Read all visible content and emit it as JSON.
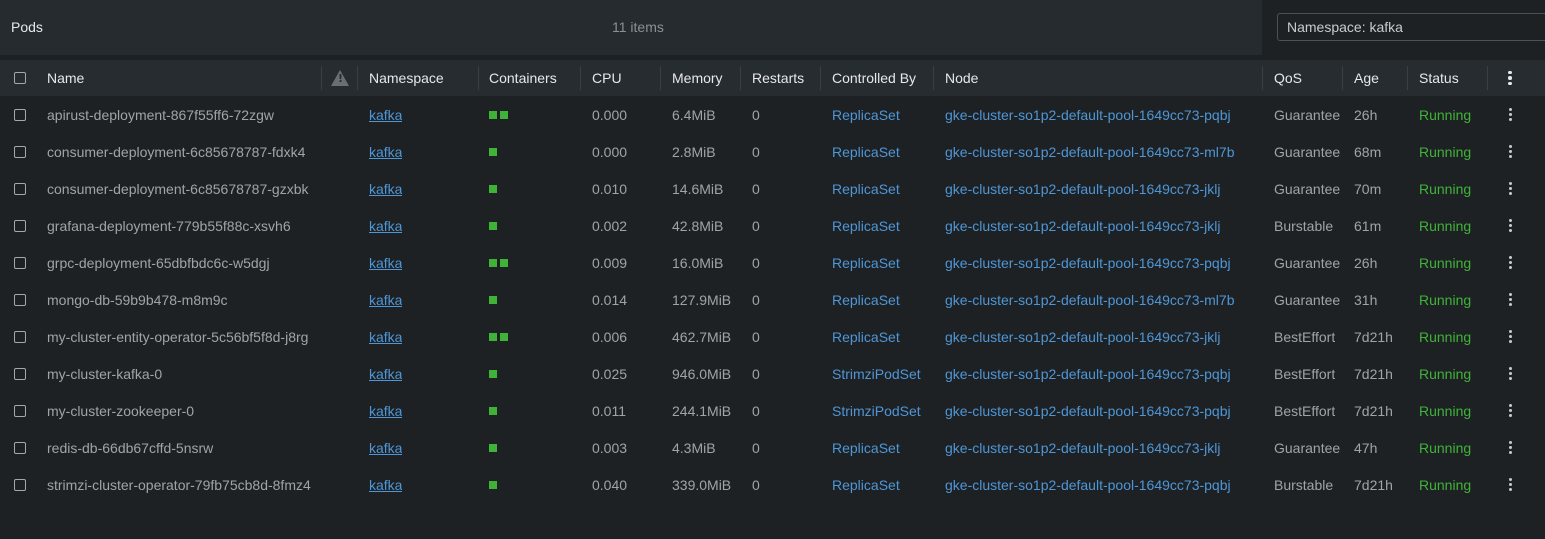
{
  "header": {
    "title": "Pods",
    "item_count": "11 items",
    "namespace_filter": "Namespace: kafka"
  },
  "columns": [
    "Name",
    "Namespace",
    "Containers",
    "CPU",
    "Memory",
    "Restarts",
    "Controlled By",
    "Node",
    "QoS",
    "Age",
    "Status"
  ],
  "column_icons": {
    "warning": "warning-triangle-icon",
    "menu": "kebab-menu-icon"
  },
  "colors": {
    "link": "#4e96d6",
    "running": "#3fb338",
    "container_ok": "#3fb338"
  },
  "pods": [
    {
      "name": "apirust-deployment-867f55ff6-72zgw",
      "namespace": "kafka",
      "containers": 2,
      "cpu": "0.000",
      "memory": "6.4MiB",
      "restarts": "0",
      "controlled_by": "ReplicaSet",
      "node": "gke-cluster-so1p2-default-pool-1649cc73-pqbj",
      "qos": "Guarantee",
      "age": "26h",
      "status": "Running"
    },
    {
      "name": "consumer-deployment-6c85678787-fdxk4",
      "namespace": "kafka",
      "containers": 1,
      "cpu": "0.000",
      "memory": "2.8MiB",
      "restarts": "0",
      "controlled_by": "ReplicaSet",
      "node": "gke-cluster-so1p2-default-pool-1649cc73-ml7b",
      "qos": "Guarantee",
      "age": "68m",
      "status": "Running"
    },
    {
      "name": "consumer-deployment-6c85678787-gzxbk",
      "namespace": "kafka",
      "containers": 1,
      "cpu": "0.010",
      "memory": "14.6MiB",
      "restarts": "0",
      "controlled_by": "ReplicaSet",
      "node": "gke-cluster-so1p2-default-pool-1649cc73-jklj",
      "qos": "Guarantee",
      "age": "70m",
      "status": "Running"
    },
    {
      "name": "grafana-deployment-779b55f88c-xsvh6",
      "namespace": "kafka",
      "containers": 1,
      "cpu": "0.002",
      "memory": "42.8MiB",
      "restarts": "0",
      "controlled_by": "ReplicaSet",
      "node": "gke-cluster-so1p2-default-pool-1649cc73-jklj",
      "qos": "Burstable",
      "age": "61m",
      "status": "Running"
    },
    {
      "name": "grpc-deployment-65dbfbdc6c-w5dgj",
      "namespace": "kafka",
      "containers": 2,
      "cpu": "0.009",
      "memory": "16.0MiB",
      "restarts": "0",
      "controlled_by": "ReplicaSet",
      "node": "gke-cluster-so1p2-default-pool-1649cc73-pqbj",
      "qos": "Guarantee",
      "age": "26h",
      "status": "Running"
    },
    {
      "name": "mongo-db-59b9b478-m8m9c",
      "namespace": "kafka",
      "containers": 1,
      "cpu": "0.014",
      "memory": "127.9MiB",
      "restarts": "0",
      "controlled_by": "ReplicaSet",
      "node": "gke-cluster-so1p2-default-pool-1649cc73-ml7b",
      "qos": "Guarantee",
      "age": "31h",
      "status": "Running"
    },
    {
      "name": "my-cluster-entity-operator-5c56bf5f8d-j8rg",
      "namespace": "kafka",
      "containers": 2,
      "cpu": "0.006",
      "memory": "462.7MiB",
      "restarts": "0",
      "controlled_by": "ReplicaSet",
      "node": "gke-cluster-so1p2-default-pool-1649cc73-jklj",
      "qos": "BestEffort",
      "age": "7d21h",
      "status": "Running"
    },
    {
      "name": "my-cluster-kafka-0",
      "namespace": "kafka",
      "containers": 1,
      "cpu": "0.025",
      "memory": "946.0MiB",
      "restarts": "0",
      "controlled_by": "StrimziPodSet",
      "node": "gke-cluster-so1p2-default-pool-1649cc73-pqbj",
      "qos": "BestEffort",
      "age": "7d21h",
      "status": "Running"
    },
    {
      "name": "my-cluster-zookeeper-0",
      "namespace": "kafka",
      "containers": 1,
      "cpu": "0.011",
      "memory": "244.1MiB",
      "restarts": "0",
      "controlled_by": "StrimziPodSet",
      "node": "gke-cluster-so1p2-default-pool-1649cc73-pqbj",
      "qos": "BestEffort",
      "age": "7d21h",
      "status": "Running"
    },
    {
      "name": "redis-db-66db67cffd-5nsrw",
      "namespace": "kafka",
      "containers": 1,
      "cpu": "0.003",
      "memory": "4.3MiB",
      "restarts": "0",
      "controlled_by": "ReplicaSet",
      "node": "gke-cluster-so1p2-default-pool-1649cc73-jklj",
      "qos": "Guarantee",
      "age": "47h",
      "status": "Running"
    },
    {
      "name": "strimzi-cluster-operator-79fb75cb8d-8fmz4",
      "namespace": "kafka",
      "containers": 1,
      "cpu": "0.040",
      "memory": "339.0MiB",
      "restarts": "0",
      "controlled_by": "ReplicaSet",
      "node": "gke-cluster-so1p2-default-pool-1649cc73-pqbj",
      "qos": "Burstable",
      "age": "7d21h",
      "status": "Running"
    }
  ]
}
